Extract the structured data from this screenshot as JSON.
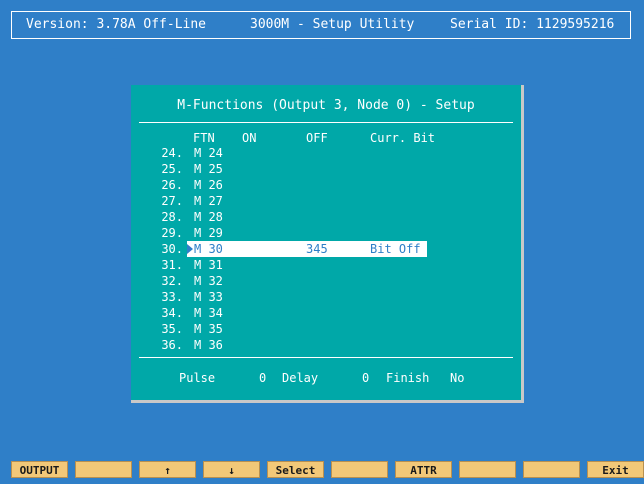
{
  "header": {
    "version": "Version: 3.78A Off-Line",
    "title": "3000M - Setup Utility",
    "serial": "Serial ID: 1129595216"
  },
  "dialog": {
    "title": "M-Functions (Output 3, Node 0) - Setup",
    "columns": {
      "ftn": "FTN",
      "on": "ON",
      "off": "OFF",
      "bit": "Curr. Bit"
    },
    "rows": [
      {
        "num": "24.",
        "ftn": "M 24",
        "off": "",
        "bit": ""
      },
      {
        "num": "25.",
        "ftn": "M 25",
        "off": "",
        "bit": ""
      },
      {
        "num": "26.",
        "ftn": "M 26",
        "off": "",
        "bit": ""
      },
      {
        "num": "27.",
        "ftn": "M 27",
        "off": "",
        "bit": ""
      },
      {
        "num": "28.",
        "ftn": "M 28",
        "off": "",
        "bit": ""
      },
      {
        "num": "29.",
        "ftn": "M 29",
        "off": "",
        "bit": ""
      },
      {
        "num": "30.",
        "ftn": "M 30",
        "off": "345",
        "bit": "Bit Off"
      },
      {
        "num": "31.",
        "ftn": "M 31",
        "off": "",
        "bit": ""
      },
      {
        "num": "32.",
        "ftn": "M 32",
        "off": "",
        "bit": ""
      },
      {
        "num": "33.",
        "ftn": "M 33",
        "off": "",
        "bit": ""
      },
      {
        "num": "34.",
        "ftn": "M 34",
        "off": "",
        "bit": ""
      },
      {
        "num": "35.",
        "ftn": "M 35",
        "off": "",
        "bit": ""
      },
      {
        "num": "36.",
        "ftn": "M 36",
        "off": "",
        "bit": ""
      }
    ],
    "selected_row": 6,
    "footer": {
      "pulse_label": "Pulse",
      "pulse_value": "0",
      "delay_label": "Delay",
      "delay_value": "0",
      "finish_label": "Finish",
      "finish_value": "No"
    }
  },
  "fkeys": [
    "OUTPUT",
    "",
    "↑",
    "↓",
    "Select",
    "",
    "ATTR",
    "",
    "",
    "Exit"
  ],
  "colors": {
    "background": "#2f7fc8",
    "dialog": "#00a8a8",
    "fkey": "#f2c878",
    "selection": "#ffffff"
  }
}
